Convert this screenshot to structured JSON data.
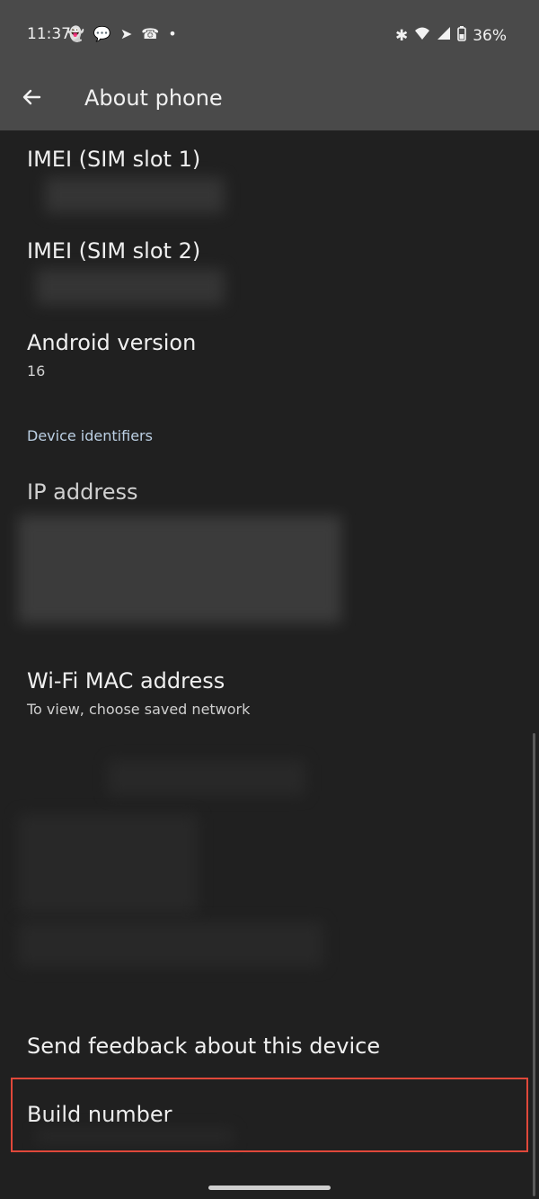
{
  "status_bar": {
    "time": "11:37",
    "battery": "36%",
    "left_icons": [
      "snapchat-icon",
      "chat-icon",
      "telegram-icon",
      "whatsapp-icon",
      "dot-icon"
    ],
    "right_icons": [
      "bluetooth-icon",
      "wifi-icon",
      "signal-icon",
      "battery-icon"
    ]
  },
  "app_bar": {
    "title": "About phone"
  },
  "items": [
    {
      "title": "IMEI (SIM slot 1)"
    },
    {
      "title": "IMEI (SIM slot 2)"
    },
    {
      "title": "Android version",
      "subtitle": "16"
    },
    {
      "title": "IP address"
    },
    {
      "title": "Wi-Fi MAC address",
      "subtitle": "To view, choose saved network"
    },
    {
      "title": "Send feedback about this device"
    },
    {
      "title": "Build number"
    }
  ],
  "sections": {
    "device_identifiers": "Device identifiers"
  },
  "colors": {
    "top_bar": "#4a4a4a",
    "background": "#202020",
    "highlight": "#e0483a",
    "section_header": "#bcd0e4"
  }
}
